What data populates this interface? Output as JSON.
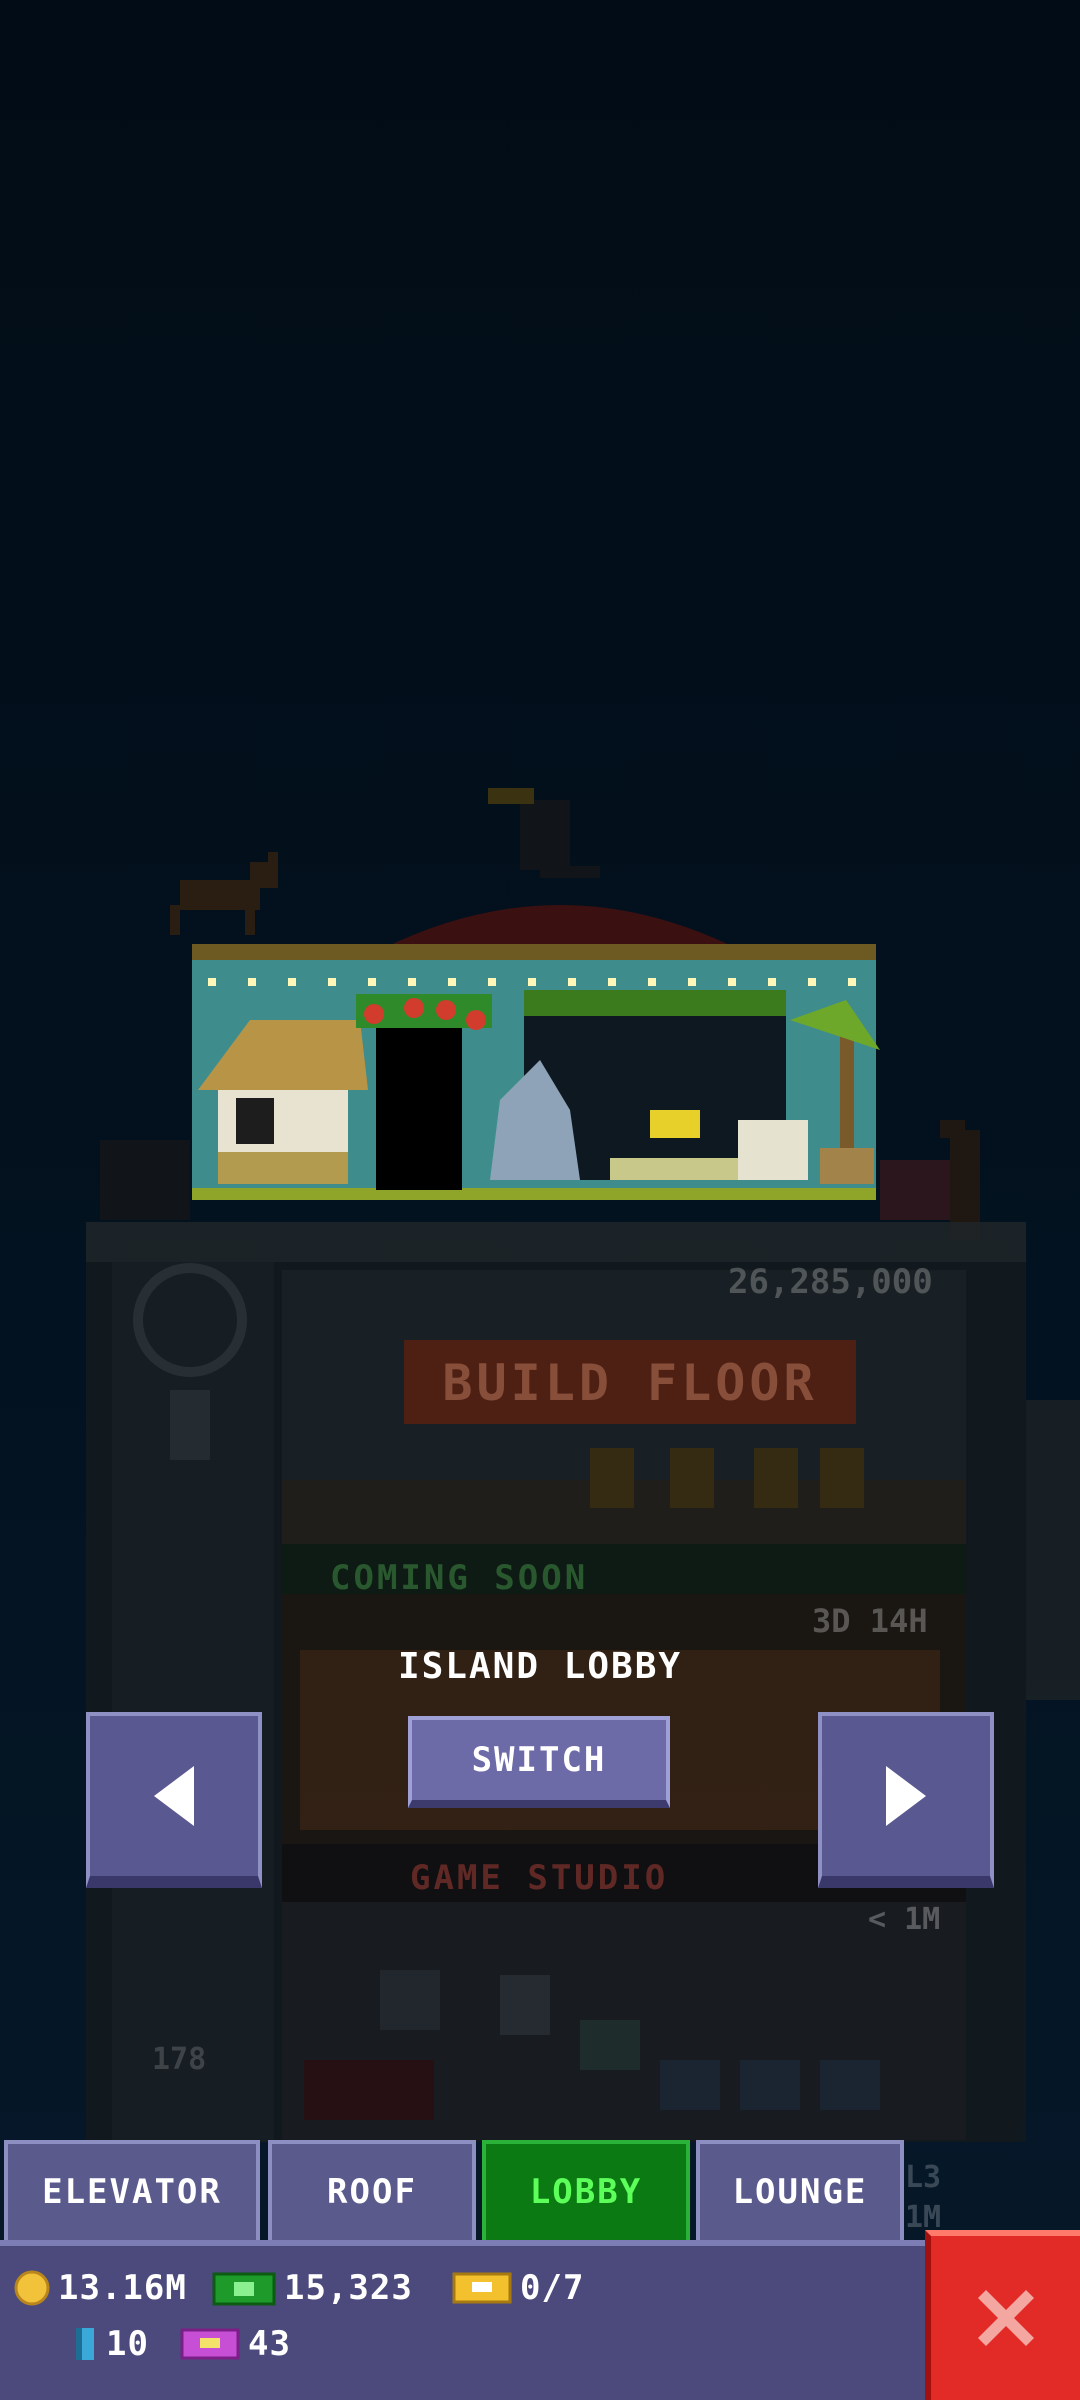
{
  "tower": {
    "floor_price": "26,285,000",
    "build_floor_label": "BUILD FLOOR",
    "coming_soon_label": "COMING SOON",
    "coming_soon_timer": "3D 14H",
    "studio_name": "GAME STUDIO",
    "studio_cost": "< 1M",
    "floor_number": "178",
    "right_labels": [
      "L3",
      "1M"
    ]
  },
  "lobby_overlay": {
    "title": "ISLAND LOBBY",
    "switch_label": "SWITCH"
  },
  "tabs": [
    {
      "label": "ELEVATOR",
      "active": false
    },
    {
      "label": "ROOF",
      "active": false
    },
    {
      "label": "LOBBY",
      "active": true
    },
    {
      "label": "LOUNGE",
      "active": false
    }
  ],
  "currency": {
    "coins": "13.16M",
    "bux": "15,323",
    "tickets": "0/7",
    "keys": "10",
    "vip": "43"
  },
  "colors": {
    "background": "#020d18",
    "button": "#5a5891",
    "active_tab": "#0b7a12",
    "close": "#e22a27"
  },
  "icons": [
    "arrow-left-icon",
    "arrow-right-icon",
    "coin-icon",
    "bux-icon",
    "ticket-icon",
    "key-icon",
    "vip-icon",
    "close-icon"
  ]
}
